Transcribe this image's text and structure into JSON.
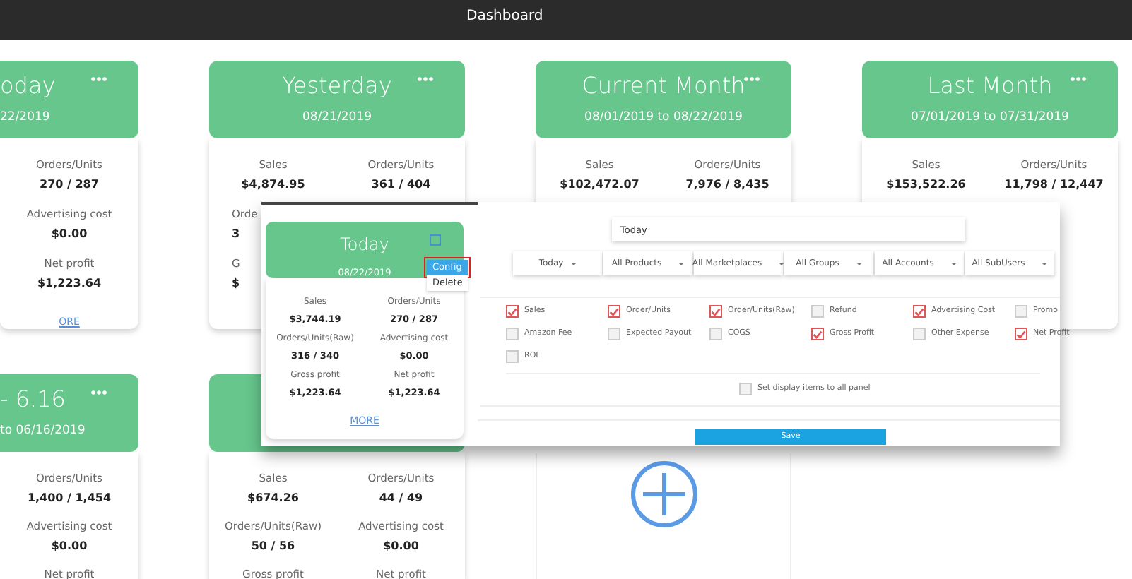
{
  "topbar": {
    "title": "Dashboard"
  },
  "rows": [
    [
      {
        "kind": "clipped",
        "title": "oday",
        "subtitle": "22/2019",
        "has_menu": true,
        "stats": [
          {
            "right": {
              "label": "Orders/Units",
              "value": "270 / 287"
            }
          },
          {
            "right": {
              "label": "Advertising cost",
              "value": "$0.00"
            }
          },
          {
            "right": {
              "label": "Net profit",
              "value": "$1,223.64"
            }
          }
        ],
        "more": "ORE"
      },
      {
        "kind": "full",
        "title": "Yesterday",
        "subtitle": "08/21/2019",
        "has_menu": true,
        "stats": [
          {
            "left": {
              "label": "Sales",
              "value": "$4,874.95"
            },
            "right": {
              "label": "Orders/Units",
              "value": "361 / 404"
            }
          },
          {
            "partial": true,
            "left": {
              "label": "Orde",
              "value": "3"
            }
          },
          {
            "partial": true,
            "left": {
              "label": "G",
              "value": "$"
            }
          }
        ]
      },
      {
        "kind": "full",
        "title": "Current Month",
        "subtitle": "08/01/2019 to 08/22/2019",
        "has_menu": true,
        "stats": [
          {
            "left": {
              "label": "Sales",
              "value": "$102,472.07"
            },
            "right": {
              "label": "Orders/Units",
              "value": "7,976 / 8,435"
            }
          }
        ]
      },
      {
        "kind": "full",
        "title": "Last Month",
        "subtitle": "07/01/2019 to 07/31/2019",
        "has_menu": true,
        "stats": [
          {
            "left": {
              "label": "Sales",
              "value": "$153,522.26"
            },
            "right": {
              "label": "Orders/Units",
              "value": "11,798 / 12,447"
            }
          }
        ]
      }
    ],
    [
      {
        "kind": "clipped",
        "title": "- 6.16",
        "subtitle": "to 06/16/2019",
        "has_menu": true,
        "stats": [
          {
            "right": {
              "label": "Orders/Units",
              "value": "1,400 / 1,454"
            }
          },
          {
            "right": {
              "label": "Advertising cost",
              "value": "$0.00"
            }
          },
          {
            "right": {
              "label": "Net profit"
            }
          }
        ]
      },
      {
        "kind": "full",
        "has_menu": false,
        "stats": [
          {
            "left": {
              "label": "Sales",
              "value": "$674.26"
            },
            "right": {
              "label": "Orders/Units",
              "value": "44 / 49"
            }
          },
          {
            "left": {
              "label": "Orders/Units(Raw)",
              "value": "50 / 56"
            },
            "right": {
              "label": "Advertising cost",
              "value": "$0.00"
            }
          },
          {
            "left": {
              "label": "Gross profit"
            },
            "right": {
              "label": "Net profit"
            }
          }
        ]
      },
      {
        "kind": "add"
      }
    ]
  ],
  "overlay": {
    "card": {
      "title": "Today",
      "subtitle": "08/22/2019",
      "stats": [
        {
          "left": {
            "label": "Sales",
            "value": "$3,744.19"
          },
          "right": {
            "label": "Orders/Units",
            "value": "270 / 287"
          }
        },
        {
          "left": {
            "label": "Orders/Units(Raw)",
            "value": "316 / 340"
          },
          "right": {
            "label": "Advertising cost",
            "value": "$0.00"
          }
        },
        {
          "left": {
            "label": "Gross profit",
            "value": "$1,223.64"
          },
          "right": {
            "label": "Net profit",
            "value": "$1,223.64"
          }
        }
      ],
      "more": "MORE",
      "menu": [
        {
          "label": "Config",
          "selected": true,
          "highlighted": true
        },
        {
          "label": "Delete",
          "selected": false,
          "highlighted": false
        }
      ]
    },
    "config": {
      "range_field": {
        "value": "Today"
      },
      "filters": [
        {
          "label": "Today"
        },
        {
          "label": "All Products"
        },
        {
          "label": "All Marketplaces"
        },
        {
          "label": "All Groups"
        },
        {
          "label": "All Accounts"
        },
        {
          "label": "All SubUsers"
        }
      ],
      "items": [
        {
          "label": "Sales",
          "checked": true
        },
        {
          "label": "Order/Units",
          "checked": true
        },
        {
          "label": "Order/Units(Raw)",
          "checked": true
        },
        {
          "label": "Refund",
          "checked": false
        },
        {
          "label": "Advertising Cost",
          "checked": true
        },
        {
          "label": "Promo",
          "checked": false
        },
        {
          "label": "Amazon Fee",
          "checked": false
        },
        {
          "label": "Expected Payout",
          "checked": false
        },
        {
          "label": "COGS",
          "checked": false
        },
        {
          "label": "Gross Profit",
          "checked": true
        },
        {
          "label": "Other Expense",
          "checked": false
        },
        {
          "label": "Net Profit",
          "checked": true
        },
        {
          "label": "ROI",
          "checked": false
        }
      ],
      "apply_all": {
        "label": "Set display items to all panel",
        "checked": false
      },
      "save": "Save"
    }
  }
}
